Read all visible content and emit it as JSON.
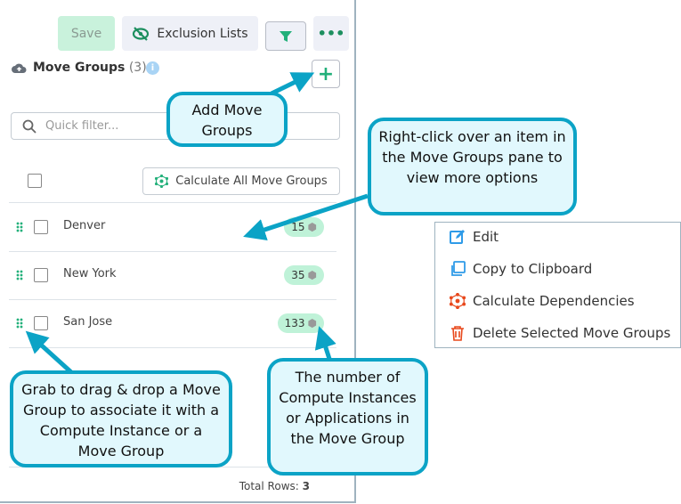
{
  "toolbar": {
    "save": "Save",
    "exclusion_lists": "Exclusion Lists"
  },
  "pane": {
    "title": "Move Groups",
    "count": "(3)",
    "filter_placeholder": "Quick filter...",
    "calculate_all": "Calculate All Move Groups",
    "rows": [
      {
        "name": "Denver",
        "count": "15"
      },
      {
        "name": "New York",
        "count": "35"
      },
      {
        "name": "San Jose",
        "count": "133"
      }
    ],
    "total_label": "Total Rows:",
    "total_value": "3"
  },
  "context_menu": {
    "items": [
      "Edit",
      "Copy to Clipboard",
      "Calculate Dependencies",
      "Delete Selected Move Groups"
    ]
  },
  "callouts": {
    "add": "Add Move Groups",
    "right_click": "Right-click over an item in the Move Groups pane to view more options",
    "drag": "Grab to drag & drop a Move Group to associate it with a Compute Instance or a Move Group",
    "count": "The number of Compute Instances or Applications in the Move Group"
  },
  "colors": {
    "accent": "#22b07a",
    "callout_border": "#0ba3c6",
    "callout_bg": "#e1f8fd"
  }
}
